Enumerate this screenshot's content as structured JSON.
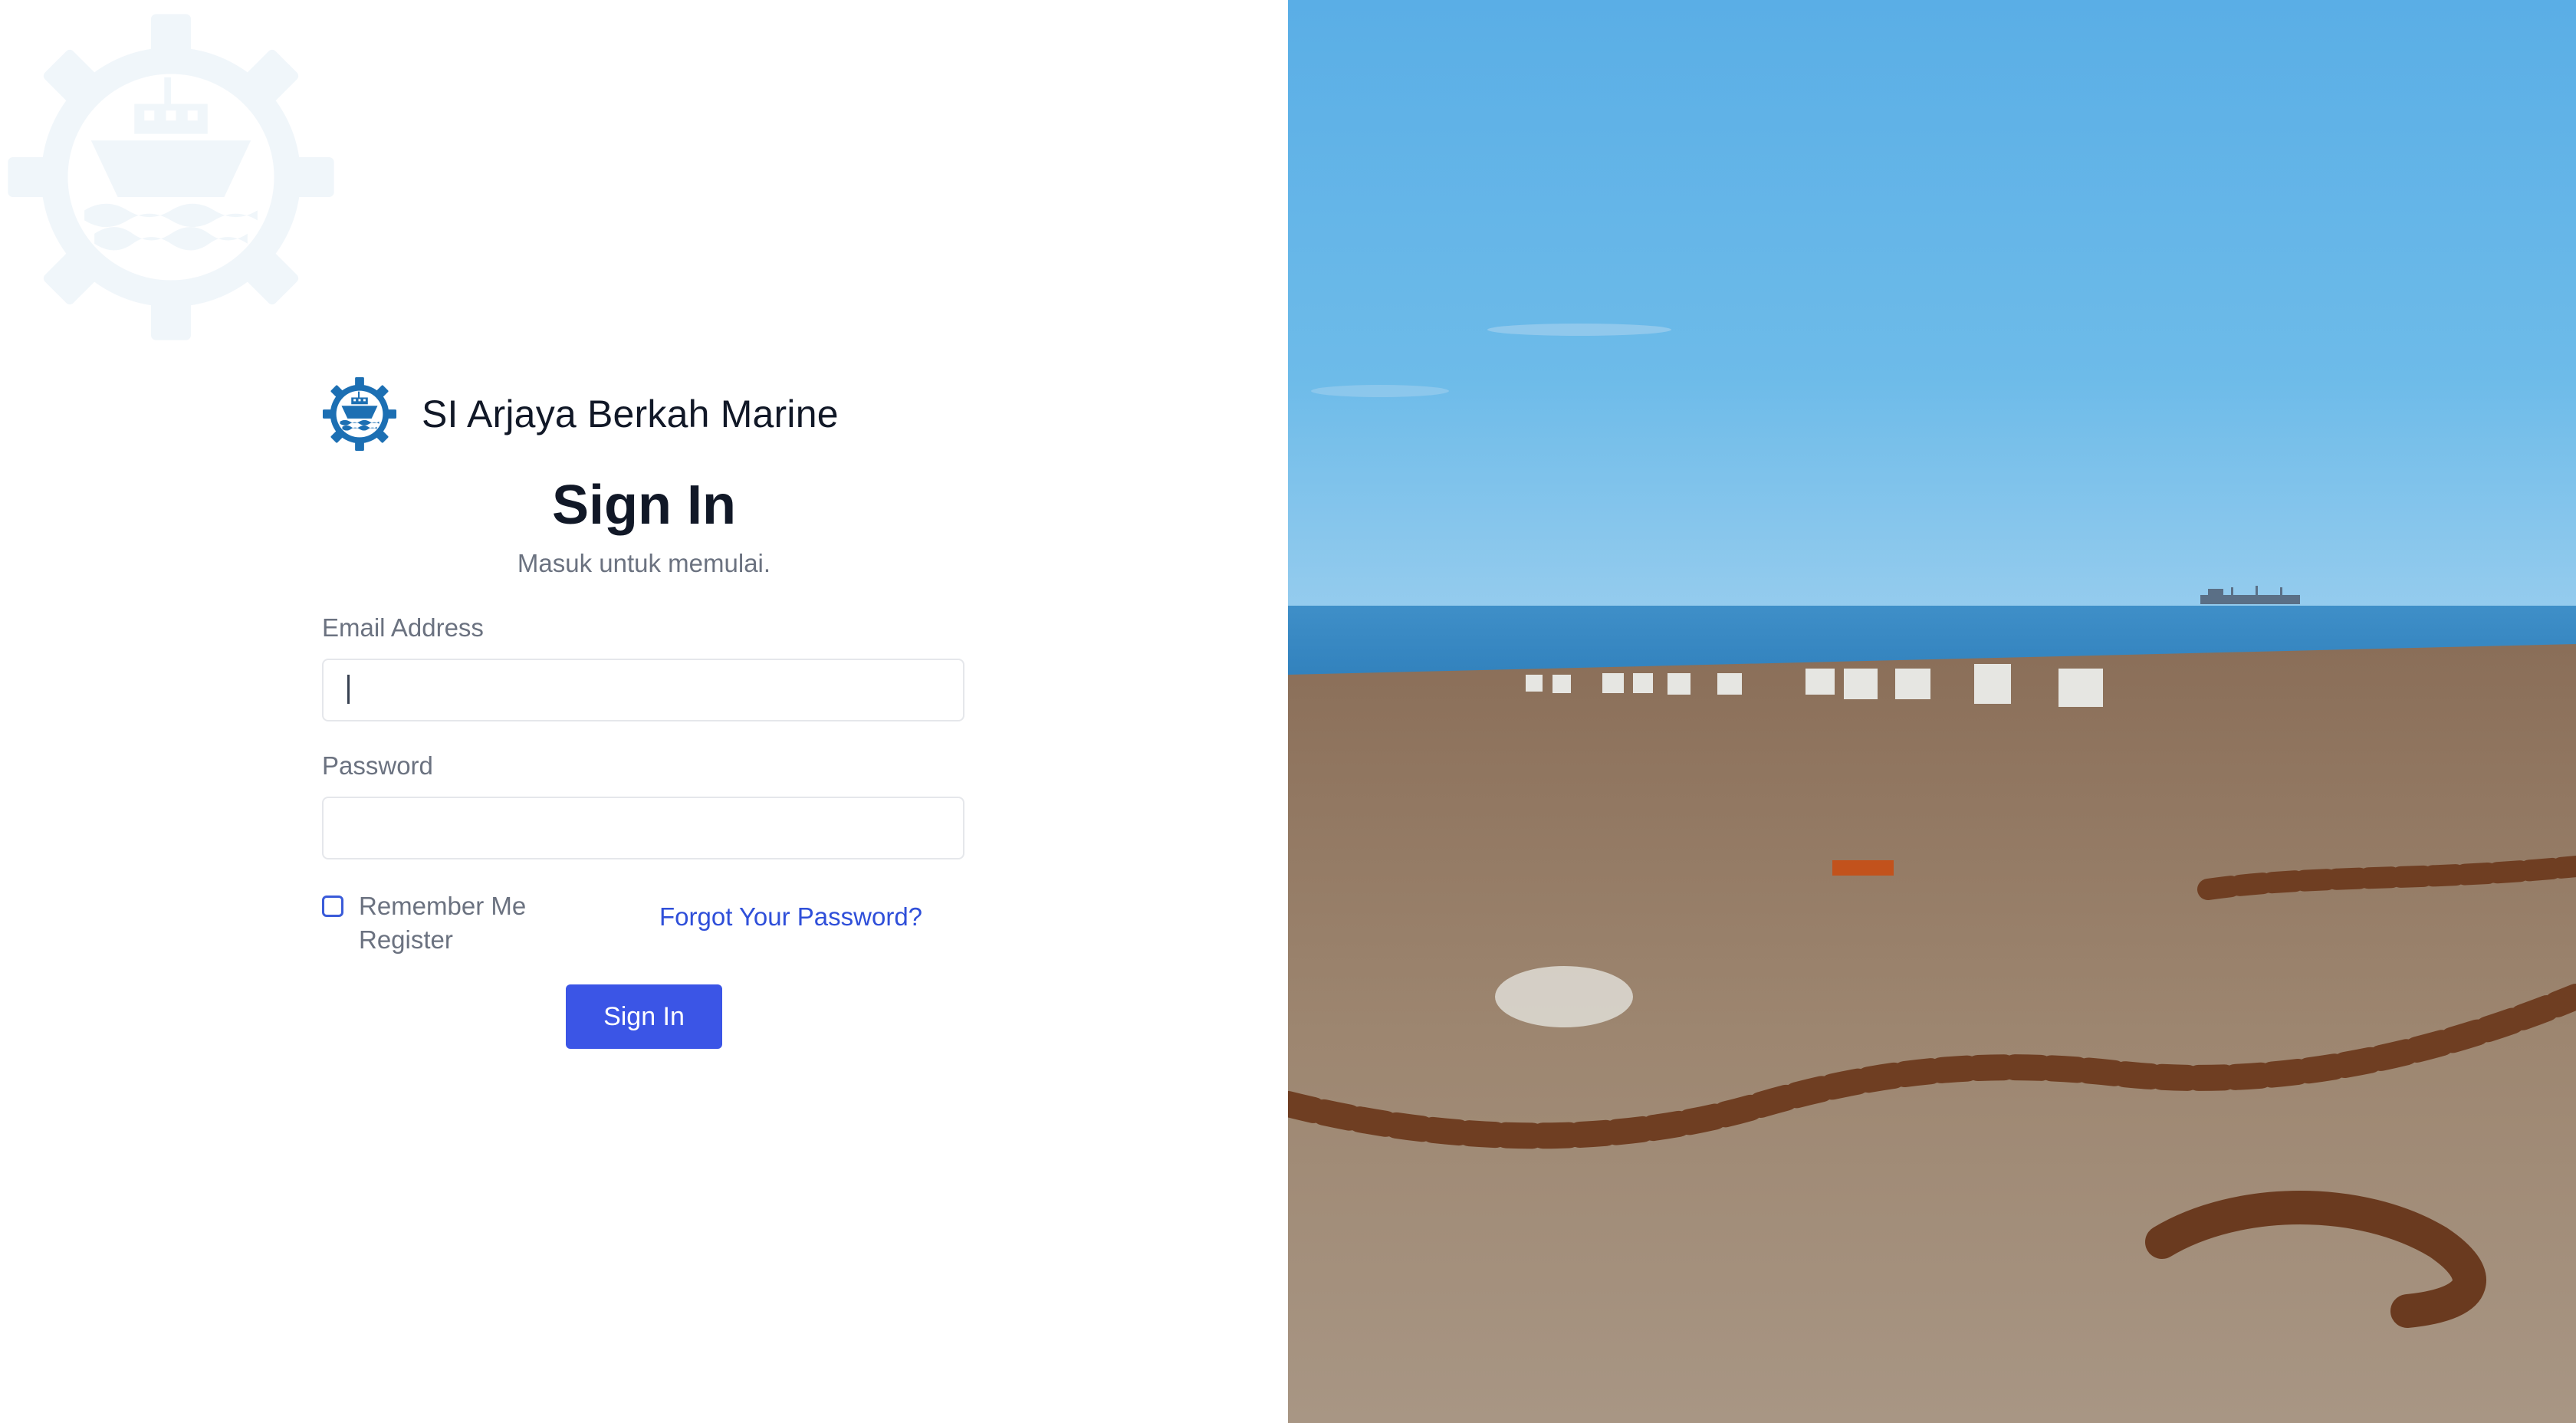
{
  "brand": {
    "name": "SI Arjaya Berkah Marine",
    "logo_icon": "ship-gear-icon",
    "accent": "#1c6fb3"
  },
  "form": {
    "title": "Sign In",
    "subtitle": "Masuk untuk memulai.",
    "email_label": "Email Address",
    "email_value": "",
    "password_label": "Password",
    "password_value": "",
    "remember_label": "Remember Me",
    "register_label": "Register",
    "forgot_label": "Forgot Your Password?",
    "submit_label": "Sign In",
    "button_color": "#3b55e6"
  },
  "hero": {
    "image": "harbor-chains-beach-photo"
  }
}
